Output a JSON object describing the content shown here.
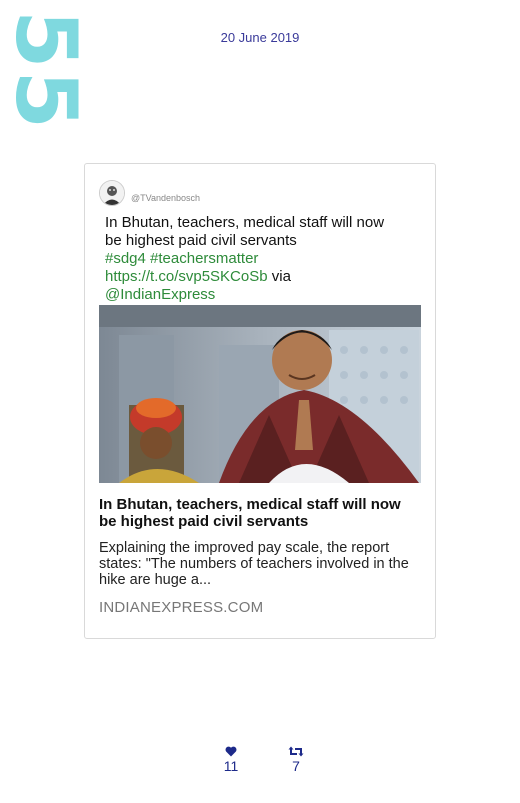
{
  "page_number": "55",
  "date": "20 June 2019",
  "tweet": {
    "handle": "@TVandenbosch",
    "text_line1": "In Bhutan, teachers, medical staff will now",
    "text_line2": "be highest paid civil servants",
    "hashtags": "#sdg4 #teachersmatter",
    "link": "https://t.co/svp5SKCoSb",
    "via": "via",
    "mention": "@IndianExpress",
    "link_card": {
      "title": "In Bhutan, teachers, medical staff will now be highest paid civil servants",
      "description": "Explaining the improved pay scale, the report states: \"The numbers of teachers involved in the hike are huge a...",
      "domain": "INDIANEXPRESS.COM"
    }
  },
  "stats": {
    "likes": "11",
    "retweets": "7"
  },
  "colors": {
    "page_number": "#7fd9df",
    "date": "#3a3a9a",
    "link_green": "#2e8b3a",
    "stats": "#1d2a8a"
  },
  "icons": {
    "likes": "heart-icon",
    "retweets": "retweet-icon"
  }
}
